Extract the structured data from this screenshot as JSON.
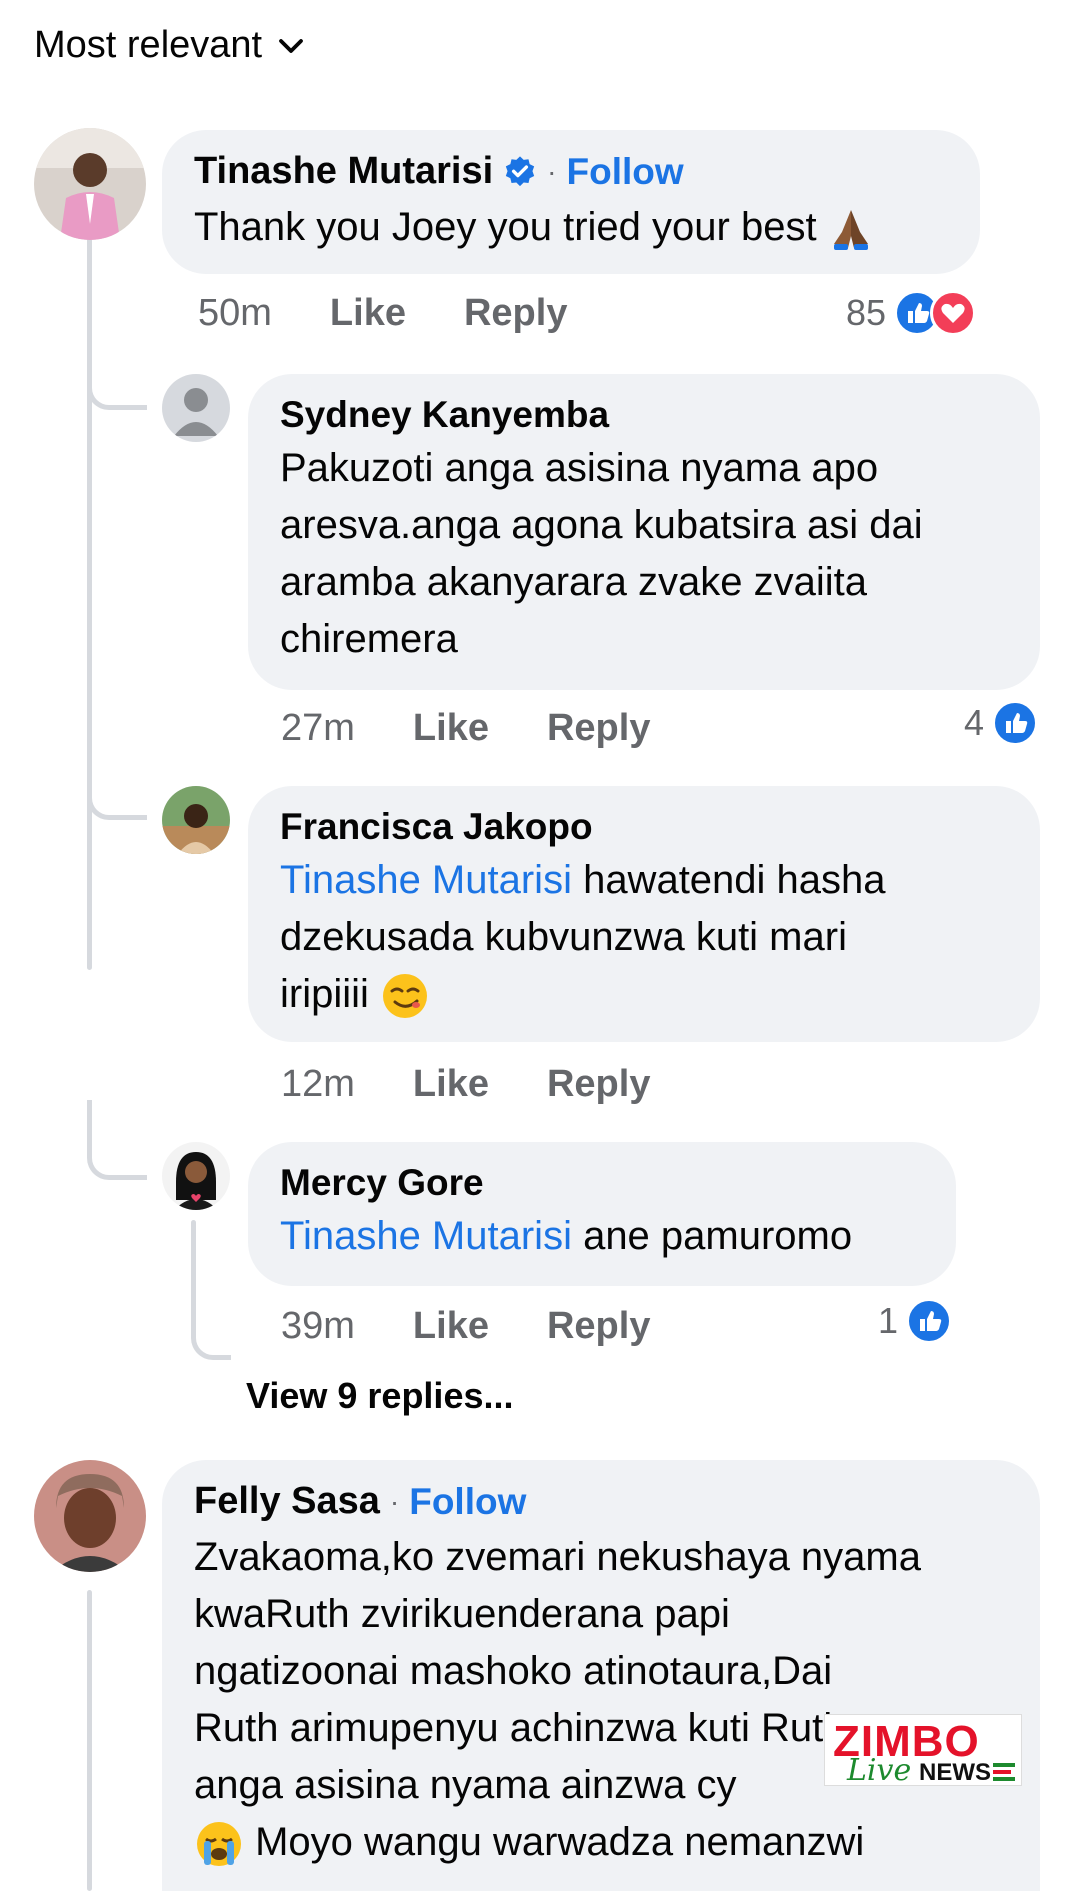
{
  "sort": {
    "label": "Most relevant"
  },
  "comments": [
    {
      "name": "Tinashe Mutarisi",
      "follow": "Follow",
      "text": "Thank you Joey you tried your best",
      "time": "50m",
      "like": "Like",
      "reply": "Reply",
      "reaction_count": "85",
      "reactions": [
        "like-icon",
        "love-icon"
      ],
      "emoji": "folded-hands-icon"
    },
    {
      "name": "Sydney Kanyemba",
      "text_lines": [
        "Pakuzoti anga asisina nyama apo",
        "aresva.anga agona kubatsira asi dai",
        "aramba akanyarara zvake zvaiita",
        "chiremera"
      ],
      "time": "27m",
      "like": "Like",
      "reply": "Reply",
      "reaction_count": "4"
    },
    {
      "name": "Francisca Jakopo",
      "mention": "Tinashe Mutarisi",
      "text_line1": " hawatendi hasha",
      "text_line2": "dzekusada kubvunzwa  kuti mari",
      "text_line3": "iripiiii",
      "time": "12m",
      "like": "Like",
      "reply": "Reply"
    },
    {
      "name": "Mercy Gore",
      "mention": "Tinashe Mutarisi",
      "text": " ane pamuromo",
      "time": "39m",
      "like": "Like",
      "reply": "Reply",
      "reaction_count": "1"
    },
    {
      "name": "Felly Sasa",
      "follow": "Follow",
      "text_lines": [
        "Zvakaoma,ko zvemari nekushaya nyama",
        "kwaRuth zvirikuenderana papi",
        "ngatizoonai mashoko atinotaura,Dai",
        "Ruth arimupenyu achinzwa kuti Ruth",
        "anga asisina nyama ainzwa cy",
        " Moyo wangu warwadza nemanzwi"
      ]
    }
  ],
  "view_replies": "View 9 replies...",
  "watermark": {
    "brand": "ZIMBO",
    "live": "Live",
    "news": "NEWS"
  },
  "colors": {
    "link": "#1b74e4",
    "bubble": "#f0f2f5",
    "meta": "#65676b",
    "love": "#f33e58"
  }
}
